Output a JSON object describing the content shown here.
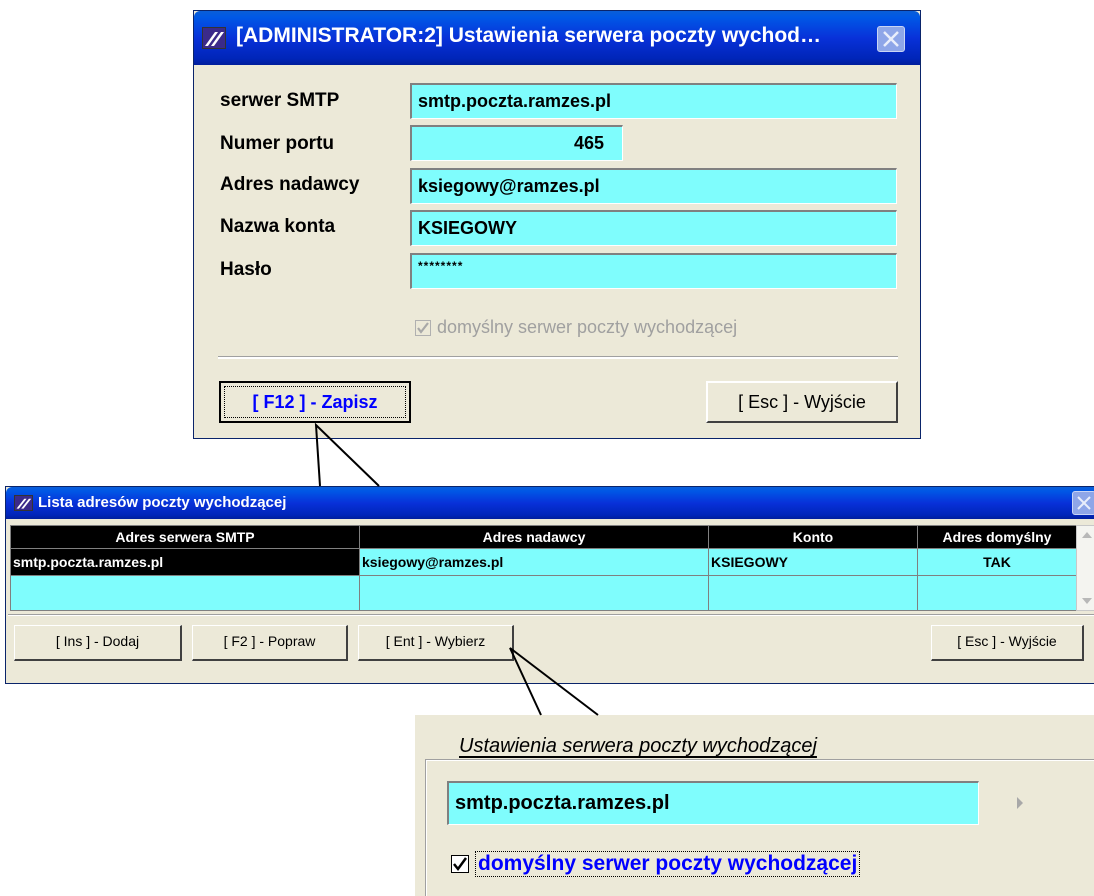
{
  "top_window": {
    "title": "[ADMINISTRATOR:2]  Ustawienia serwera poczty wychod…",
    "fields": [
      {
        "label": "serwer SMTP",
        "value": "smtp.poczta.ramzes.pl"
      },
      {
        "label": "Numer portu",
        "value": "465"
      },
      {
        "label": "Adres nadawcy",
        "value": "ksiegowy@ramzes.pl"
      },
      {
        "label": "Nazwa konta",
        "value": "KSIEGOWY"
      },
      {
        "label": "Hasło",
        "value": "********"
      }
    ],
    "checkbox_label": "domyślny serwer poczty wychodzącej",
    "checkbox_checked": true,
    "save_button": "[ F12 ] - Zapisz",
    "exit_button": "[ Esc ] - Wyjście"
  },
  "list_window": {
    "title": "Lista adresów poczty wychodzącej",
    "columns": [
      "Adres serwera SMTP",
      "Adres nadawcy",
      "Konto",
      "Adres domyślny"
    ],
    "rows": [
      [
        "smtp.poczta.ramzes.pl",
        "ksiegowy@ramzes.pl",
        "KSIEGOWY",
        "TAK"
      ]
    ],
    "buttons": {
      "add": "[ Ins ] - Dodaj",
      "edit": "[ F2 ] - Popraw",
      "choose": "[ Ent ] - Wybierz",
      "exit": "[ Esc ] - Wyjście"
    }
  },
  "panel": {
    "group_title": "Ustawienia serwera poczty wychodzącej",
    "server_value": "smtp.poczta.ramzes.pl",
    "checkbox_label": "domyślny serwer poczty wychodzącej",
    "checkbox_checked": true
  },
  "colors": {
    "field_bg": "#7ffdfd",
    "title_blue": "#0831d9",
    "button_text_blue": "#0000ff",
    "window_bg": "#ece9d8"
  }
}
